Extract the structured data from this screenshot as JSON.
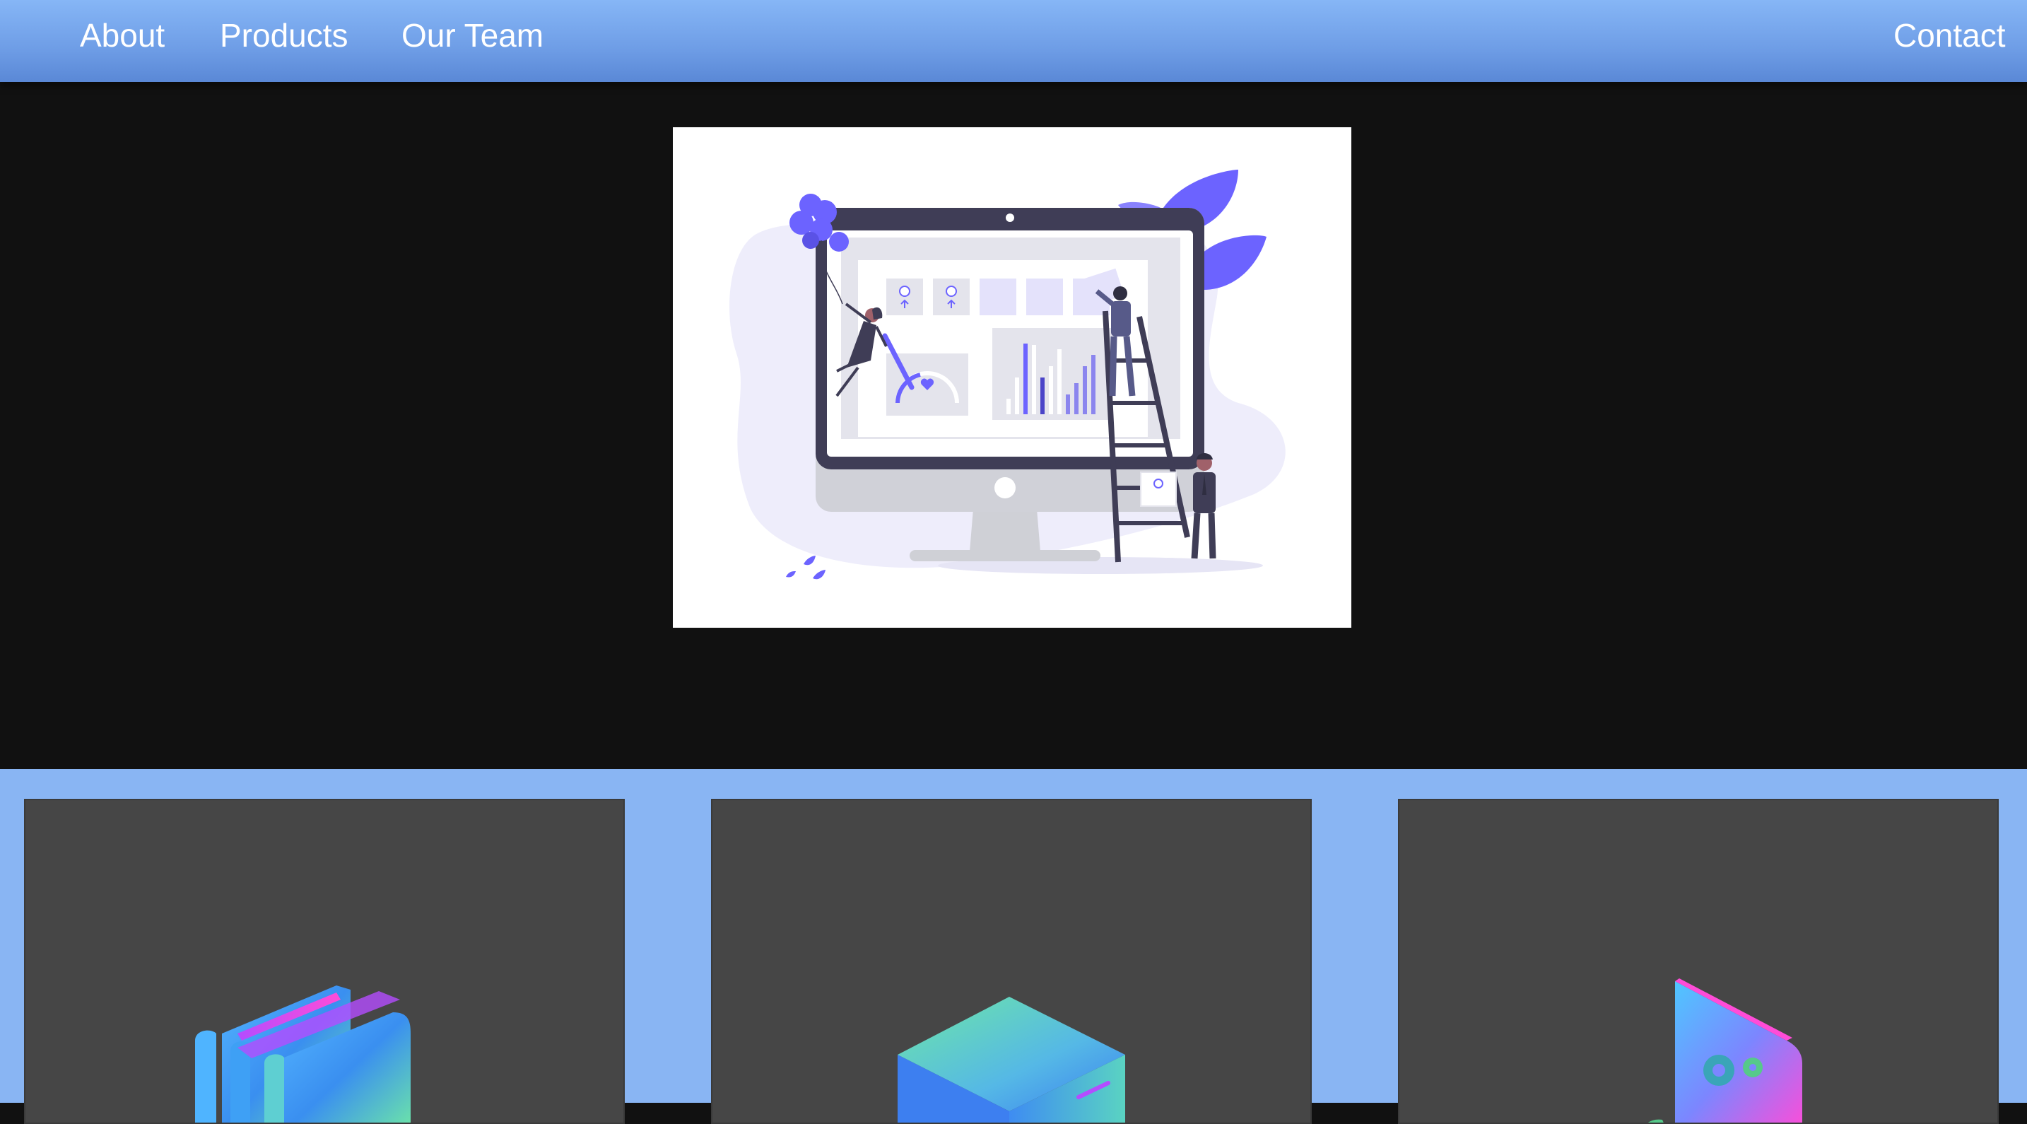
{
  "navbar": {
    "links": [
      {
        "label": "About"
      },
      {
        "label": "Products"
      },
      {
        "label": "Our Team"
      }
    ],
    "contact_label": "Contact"
  },
  "hero": {
    "illustration": "dashboard-monitor-illustration"
  },
  "features": {
    "cards": [
      {
        "icon": "stacked-folders-icon"
      },
      {
        "icon": "server-box-icon"
      },
      {
        "icon": "settings-panel-icon"
      }
    ]
  },
  "colors": {
    "navbar": "#86b6f6",
    "hero_background": "#111111",
    "features_background": "#89b5f3",
    "card_background": "#464646",
    "accent_purple": "#6c63ff"
  }
}
